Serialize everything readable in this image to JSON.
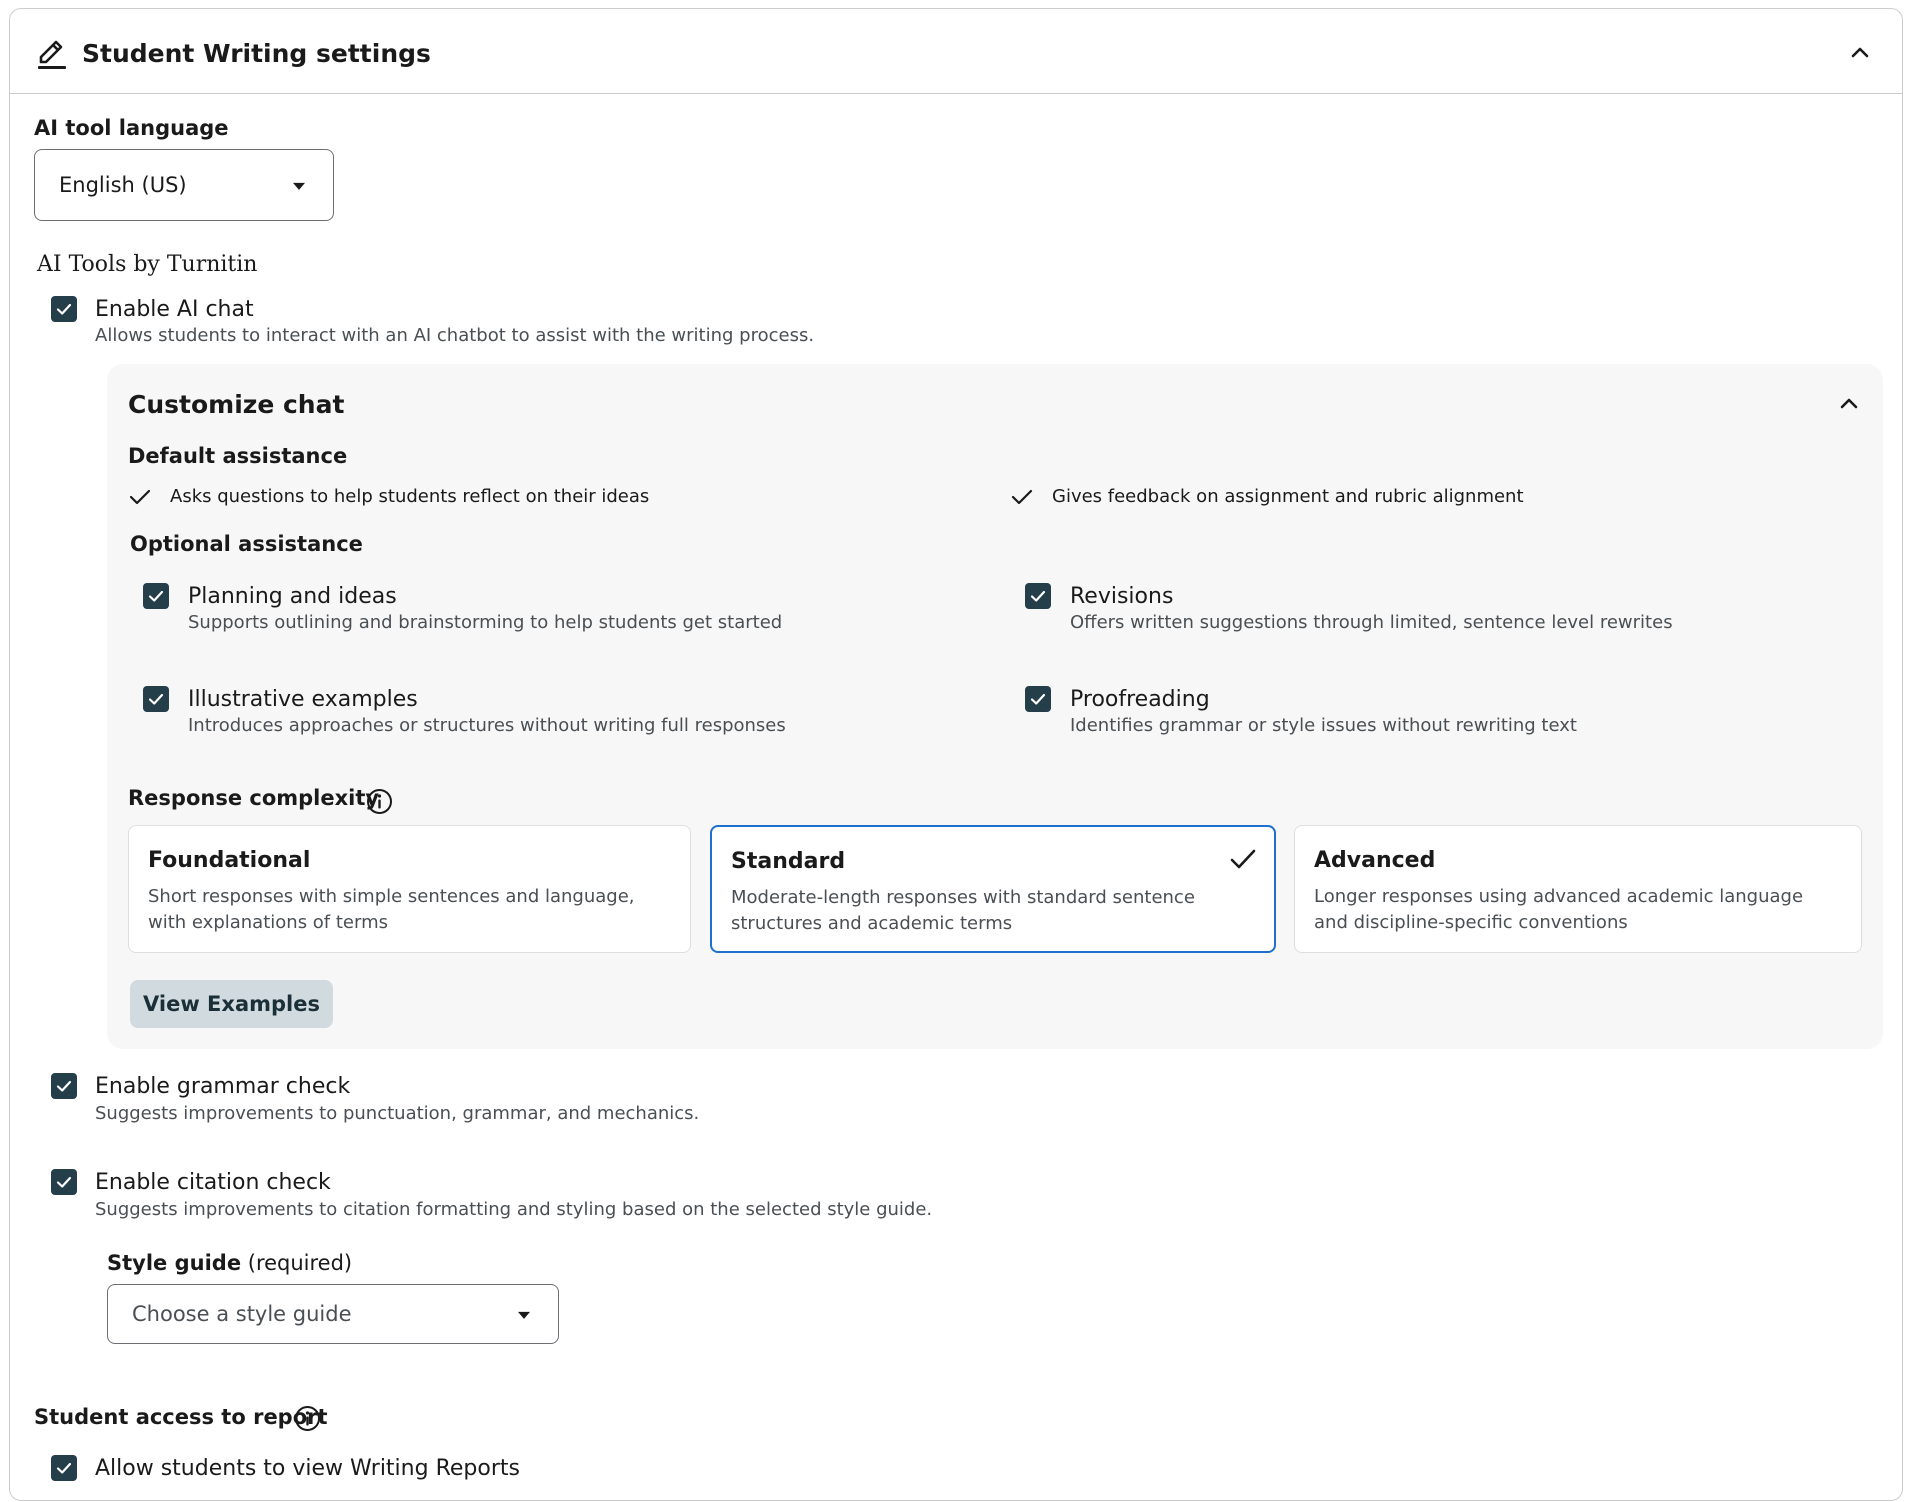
{
  "header": {
    "title": "Student Writing settings"
  },
  "language": {
    "label": "AI tool language",
    "value": "English (US)"
  },
  "ai_tools": {
    "heading": "AI Tools by Turnitin"
  },
  "ai_chat": {
    "label": "Enable AI chat",
    "description": "Allows students to interact with an AI chatbot to assist with the writing process."
  },
  "customize": {
    "title": "Customize chat",
    "default_heading": "Default assistance",
    "defaults": [
      "Asks questions to help students reflect on their ideas",
      "Gives feedback on assignment and rubric alignment"
    ],
    "optional_heading": "Optional assistance",
    "optional": [
      {
        "title": "Planning and ideas",
        "desc": "Supports outlining and brainstorming to help students get started"
      },
      {
        "title": "Revisions",
        "desc": "Offers written suggestions through limited, sentence level rewrites"
      },
      {
        "title": "Illustrative examples",
        "desc": "Introduces approaches or structures without writing full responses"
      },
      {
        "title": "Proofreading",
        "desc": "Identifies grammar or style issues without rewriting text"
      }
    ],
    "complexity_heading": "Response complexity",
    "complexity": [
      {
        "title": "Foundational",
        "desc": "Short responses with simple sentences and language, with explanations of terms"
      },
      {
        "title": "Standard",
        "desc": "Moderate-length responses with standard sentence structures and academic terms"
      },
      {
        "title": "Advanced",
        "desc": "Longer responses using advanced academic language and discipline-specific conventions"
      }
    ],
    "view_examples": "View Examples"
  },
  "grammar": {
    "label": "Enable grammar check",
    "description": "Suggests improvements to punctuation, grammar, and mechanics."
  },
  "citation": {
    "label": "Enable citation check",
    "description": "Suggests improvements to citation formatting and styling based on the selected style guide."
  },
  "style_guide": {
    "label": "Style guide",
    "required": "(required)",
    "placeholder": "Choose a style guide"
  },
  "report": {
    "heading": "Student access to report",
    "label": "Allow students to view Writing Reports"
  },
  "colors": {
    "checkbox": "#243e4a",
    "selected_border": "#1f6fcf",
    "button_bg": "#d1dade"
  }
}
